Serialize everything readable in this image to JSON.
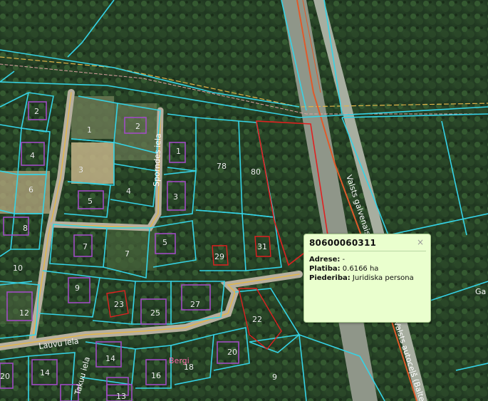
{
  "map": {
    "parcel_labels": [
      "2",
      "2",
      "1",
      "1",
      "4",
      "3",
      "3",
      "6",
      "4",
      "5",
      "8",
      "5",
      "7",
      "7",
      "10",
      "9",
      "12",
      "23",
      "25",
      "27",
      "22",
      "14",
      "14",
      "16",
      "18",
      "20",
      "20",
      "13",
      "78",
      "80",
      "29",
      "31",
      "9"
    ],
    "streets": [
      "Sporndes iela",
      "Lauvu iela",
      "Takuu iela",
      "Valsts galvenais",
      "Valsts autoceļš (Balteze...",
      "Bergi"
    ],
    "edge_label": "Ga",
    "colors": {
      "parcel_outline": "#35d3e6",
      "selected_outline": "#e02020",
      "building": "#a04bc4",
      "road": "#e2b64a",
      "rail": "#e05a2a"
    }
  },
  "popup": {
    "title": "80600060311",
    "close": "×",
    "rows": [
      {
        "key": "Adrese:",
        "value": " -"
      },
      {
        "key": "Platiba:",
        "value": " 0.6166 ha"
      },
      {
        "key": "Piederiba:",
        "value": " Juridiska persona"
      }
    ]
  }
}
